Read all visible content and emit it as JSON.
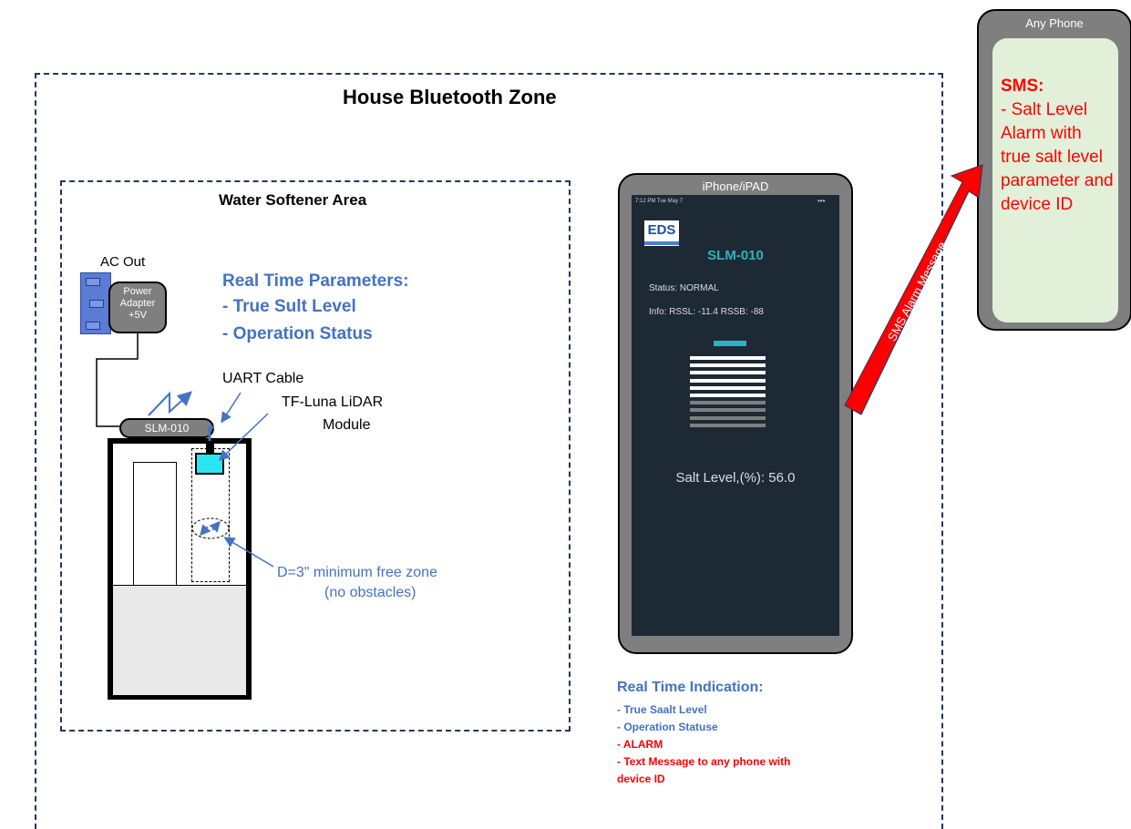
{
  "zones": {
    "house_title": "House Bluetooth Zone",
    "softener_title": "Water Softener Area"
  },
  "power": {
    "ac_out": "AC Out",
    "adapter_lines": [
      "Power",
      "Adapter",
      "+5V"
    ]
  },
  "device": {
    "slm_label": "SLM-010"
  },
  "labels": {
    "uart_cable": "UART Cable",
    "lidar_module_line1": "TF-Luna LiDAR",
    "lidar_module_line2": "Module"
  },
  "realtime_parameters": {
    "title": "Real Time Parameters:",
    "items": [
      "- True Sult Level",
      "- Operation Status"
    ]
  },
  "free_zone_note": {
    "line1": "D=3\" minimum free zone",
    "line2": "(no obstacles)"
  },
  "tablet": {
    "title": "iPhone/iPAD",
    "status_bar_time": "7:12 PM  Tue May 7",
    "status_bar_dots": "•••",
    "logo_text": "EDS",
    "device_name": "SLM-010",
    "status_line": "Status:  NORMAL",
    "info_line": "Info:   RSSL: -11.4     RSSB: -88",
    "salt_level_text": "Salt Level,(%): 56.0",
    "level_bars": {
      "total": 10,
      "filled": 6,
      "fill_color": "#ffffff",
      "empty_color": "#7f7f7f",
      "indicator_color": "#2ab4c0"
    }
  },
  "sms_arrow": {
    "label": "SMS Alarm Message",
    "color": "#ff0000"
  },
  "any_phone": {
    "title": "Any Phone",
    "sms_header": "SMS:",
    "sms_body": "- Salt Level Alarm with true salt level parameter and device ID"
  },
  "realtime_indication": {
    "title": "Real Time Indication:",
    "items": [
      {
        "text": "- True Saalt Level",
        "color": "blue"
      },
      {
        "text": "- Operation Statuse",
        "color": "blue"
      },
      {
        "text": "- ALARM",
        "color": "red"
      },
      {
        "text": "- Text Message to any phone with",
        "color": "red"
      },
      {
        "text": "device ID",
        "color": "red"
      }
    ]
  },
  "colors": {
    "zone_border": "#1f3864",
    "accent_blue": "#4472c4",
    "alarm_red": "#ff0000",
    "lidar_cyan": "#29e6f0",
    "device_gray": "#7f7f7f"
  }
}
